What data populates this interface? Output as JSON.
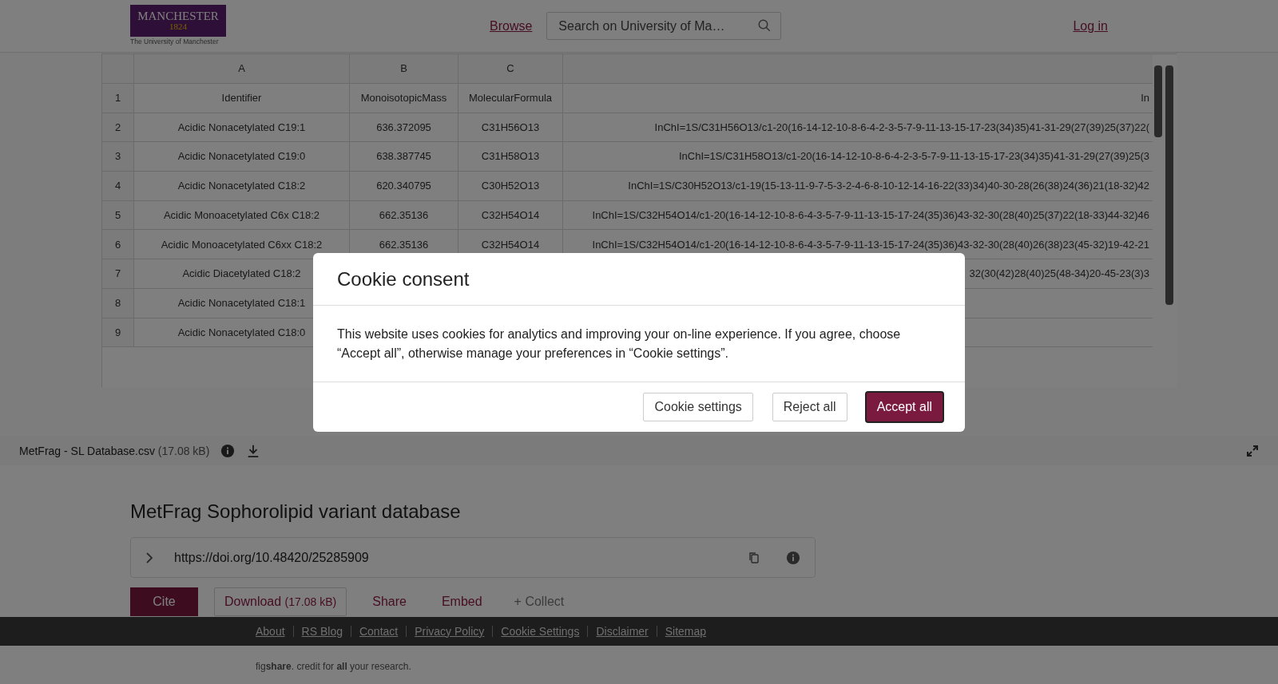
{
  "header": {
    "logo": {
      "name": "MANCHESTER",
      "year": "1824",
      "subtitle": "The University of Manchester"
    },
    "browse_link": "Browse",
    "search": {
      "placeholder": "Search on University of Ma…"
    },
    "login_link": "Log in"
  },
  "table": {
    "columns": [
      "A",
      "B",
      "C"
    ],
    "rows": [
      {
        "number": "1",
        "cells": [
          "Identifier",
          "MonoisotopicMass",
          "MolecularFormula",
          "In"
        ]
      },
      {
        "number": "2",
        "cells": [
          "Acidic Nonacetylated C19:1",
          "636.372095",
          "C31H56O13",
          "InChI=1S/C31H56O13/c1-20(16-14-12-10-8-6-4-2-3-5-7-9-11-13-15-17-23(34)35)41-31-29(27(39)25(37)22("
        ]
      },
      {
        "number": "3",
        "cells": [
          "Acidic Nonacetylated C19:0",
          "638.387745",
          "C31H58O13",
          "InChI=1S/C31H58O13/c1-20(16-14-12-10-8-6-4-2-3-5-7-9-11-13-15-17-23(34)35)41-31-29(27(39)25(3"
        ]
      },
      {
        "number": "4",
        "cells": [
          "Acidic Nonacetylated C18:2",
          "620.340795",
          "C30H52O13",
          "InChI=1S/C30H52O13/c1-19(15-13-11-9-7-5-3-2-4-6-8-10-12-14-16-22(33)34)40-30-28(26(38)24(36)21(18-32)42"
        ]
      },
      {
        "number": "5",
        "cells": [
          "Acidic Monoacetylated C6x C18:2",
          "662.35136",
          "C32H54O14",
          "InChI=1S/C32H54O14/c1-20(16-14-12-10-8-6-4-3-5-7-9-11-13-15-17-24(35)36)43-32-30(28(40)25(37)22(18-33)44-32)46"
        ]
      },
      {
        "number": "6",
        "cells": [
          "Acidic Monoacetylated C6xx C18:2",
          "662.35136",
          "C32H54O14",
          "InChI=1S/C32H54O14/c1-20(16-14-12-10-8-6-4-3-5-7-9-11-13-15-17-24(35)36)43-32-30(28(40)26(38)23(45-32)19-42-21"
        ]
      },
      {
        "number": "7",
        "cells": [
          "Acidic Diacetylated C18:2",
          "",
          "",
          "32(30(42)28(40)25(48-34)20-45-23(3)3"
        ]
      },
      {
        "number": "8",
        "cells": [
          "Acidic Nonacetylated C18:1",
          "",
          "",
          ""
        ]
      },
      {
        "number": "9",
        "cells": [
          "Acidic Nonacetylated C18:0",
          "",
          "",
          ""
        ]
      }
    ]
  },
  "file_bar": {
    "name": "MetFrag - SL Database.csv",
    "size": "(17.08 kB)"
  },
  "item": {
    "title": "MetFrag Sophorolipid variant database",
    "doi": "https://doi.org/10.48420/25285909",
    "actions": [
      {
        "kind": "primary",
        "label": "Cite"
      },
      {
        "kind": "outline",
        "label": "Download",
        "size": "(17.08 kB)"
      },
      {
        "kind": "link",
        "label": "Share"
      },
      {
        "kind": "link",
        "label": "Embed"
      },
      {
        "kind": "muted",
        "label": "+ Collect"
      }
    ]
  },
  "footer": {
    "links": [
      "About",
      "RS Blog",
      "Contact",
      "Privacy Policy",
      "Cookie Settings",
      "Disclaimer",
      "Sitemap"
    ],
    "tagline": "fig**share**. credit for **all** your research."
  },
  "modal": {
    "title": "Cookie consent",
    "body": "This website uses cookies for analytics and improving your on-line experience. If you agree, choose “Accept all”, otherwise manage your preferences in “Cookie settings”.",
    "buttons": [
      {
        "label": "Cookie settings",
        "kind": "secondary"
      },
      {
        "label": "Reject all",
        "kind": "secondary"
      },
      {
        "label": "Accept all",
        "kind": "primary"
      }
    ]
  }
}
